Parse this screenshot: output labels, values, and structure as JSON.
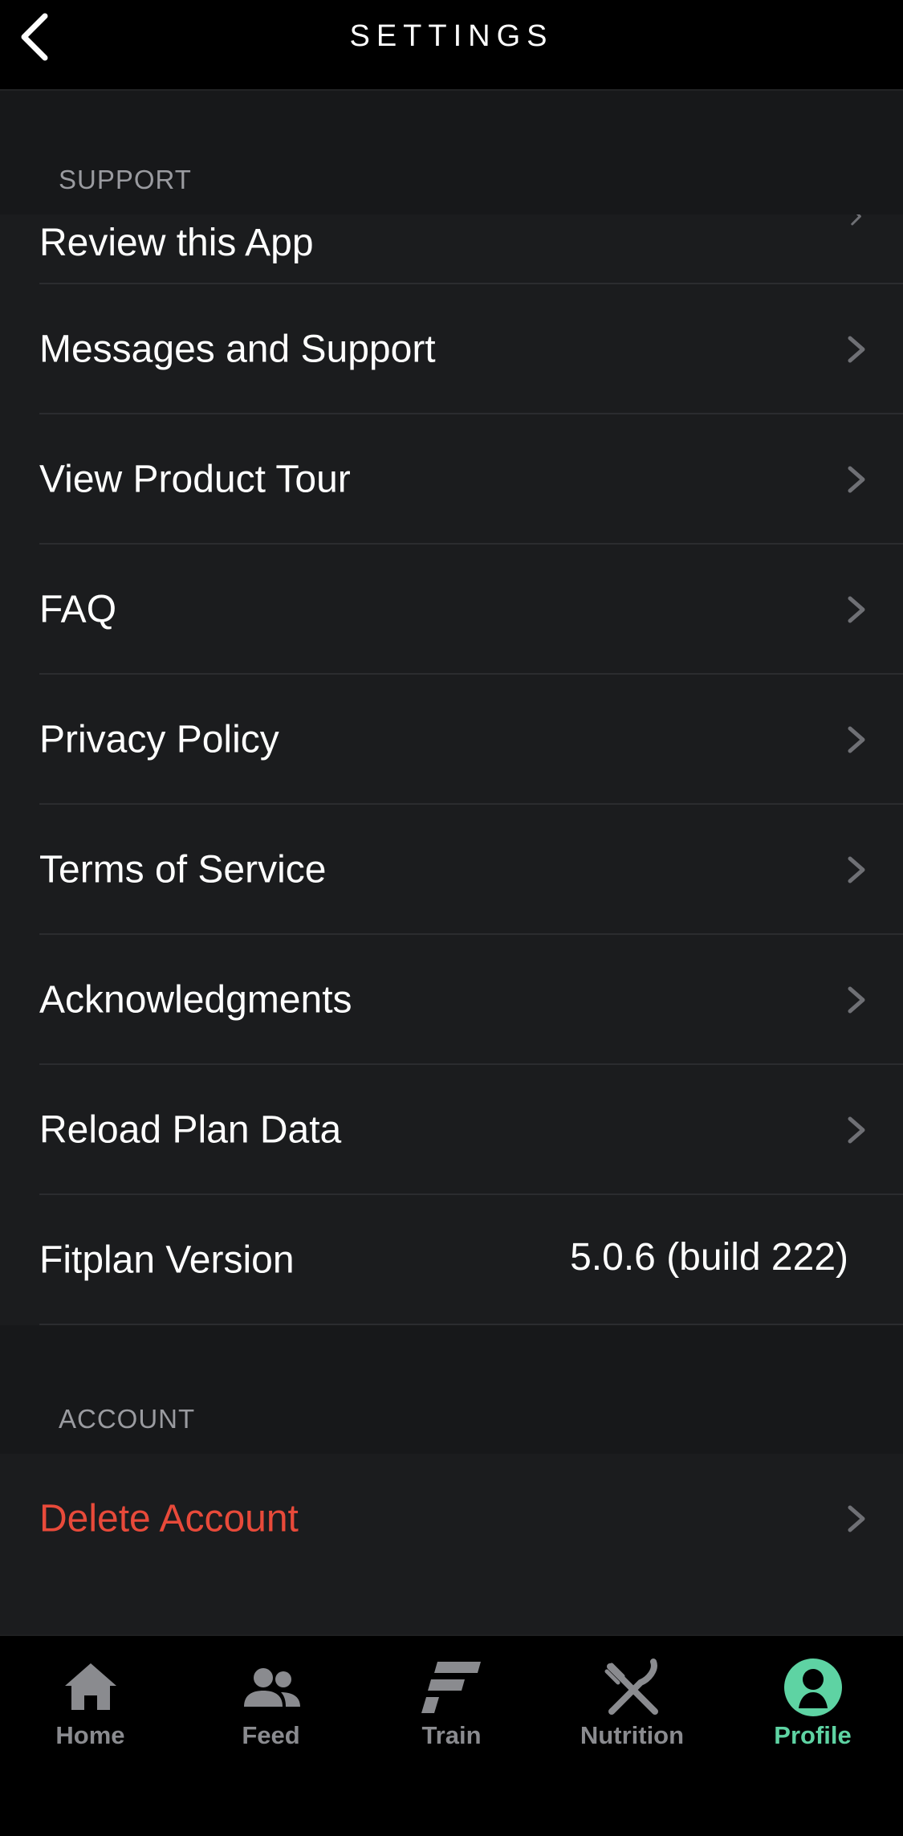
{
  "header": {
    "title": "SETTINGS"
  },
  "sections": {
    "support": {
      "title": "SUPPORT",
      "items": [
        {
          "label": "Review this App"
        },
        {
          "label": "Messages and Support"
        },
        {
          "label": "View Product Tour"
        },
        {
          "label": "FAQ"
        },
        {
          "label": "Privacy Policy"
        },
        {
          "label": "Terms of Service"
        },
        {
          "label": "Acknowledgments"
        },
        {
          "label": "Reload Plan Data"
        }
      ],
      "version": {
        "label": "Fitplan Version",
        "value": "5.0.6 (build 222)"
      }
    },
    "account": {
      "title": "ACCOUNT",
      "items": [
        {
          "label": "Delete Account"
        }
      ]
    }
  },
  "tabbar": {
    "tabs": [
      {
        "label": "Home",
        "icon": "home-icon"
      },
      {
        "label": "Feed",
        "icon": "people-icon"
      },
      {
        "label": "Train",
        "icon": "fitplan-logo-icon"
      },
      {
        "label": "Nutrition",
        "icon": "fork-knife-icon"
      },
      {
        "label": "Profile",
        "icon": "profile-icon",
        "active": true
      }
    ]
  },
  "colors": {
    "background": "#1b1c1e",
    "accent": "#5ed3a3",
    "danger": "#e84a3a",
    "inactive_tab": "#8a8b8f"
  }
}
